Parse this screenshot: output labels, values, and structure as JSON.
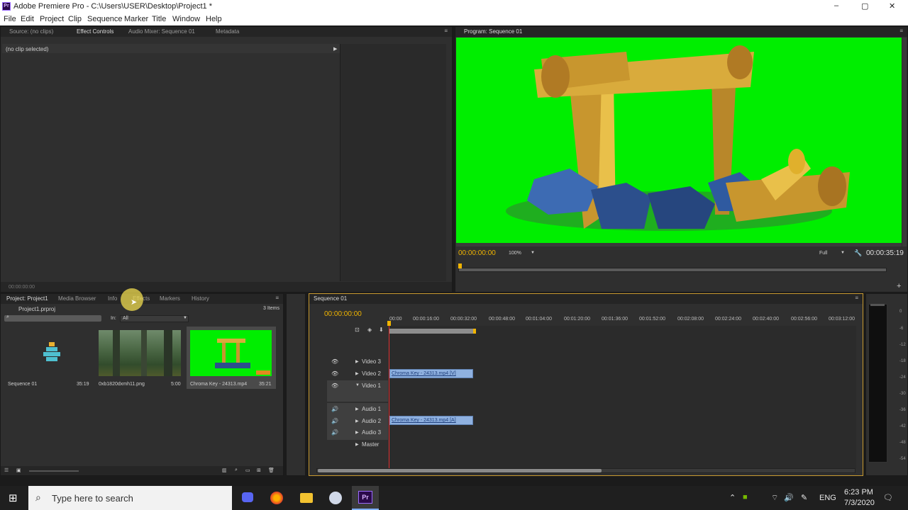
{
  "window": {
    "title": "Adobe Premiere Pro - C:\\Users\\USER\\Desktop\\Project1 *",
    "app_icon_label": "Pr",
    "controls": [
      "–",
      "▢",
      "✕"
    ]
  },
  "menu": [
    "File",
    "Edit",
    "Project",
    "Clip",
    "Sequence",
    "Marker",
    "Title",
    "Window",
    "Help"
  ],
  "source_panel": {
    "tabs": [
      "Source: (no clips)",
      "Effect Controls",
      "Audio Mixer: Sequence 01",
      "Metadata"
    ],
    "active_tab": "Effect Controls",
    "no_clip": "(no clip selected)",
    "timecode": "00:00:00:00"
  },
  "program_monitor": {
    "tab": "Program: Sequence 01",
    "timecode_current": "00:00:00:00",
    "zoom": "100%",
    "quality": "Full",
    "duration": "00:00:35:19"
  },
  "project_panel": {
    "tabs": [
      "Project: Project1",
      "Media Browser",
      "Info",
      "Effects",
      "Markers",
      "History"
    ],
    "active_tab": "Project: Project1",
    "file": "Project1.prproj",
    "item_count": "3 Items",
    "in_label": "In:",
    "in_value": "All",
    "items": [
      {
        "name": "Sequence 01",
        "duration": "35:19"
      },
      {
        "name": "0xb1820dxmh11.png",
        "duration": "5:00"
      },
      {
        "name": "Chroma Key - 24313.mp4",
        "duration": "35:21"
      }
    ]
  },
  "timeline": {
    "tab": "Sequence 01",
    "timecode": "00:00:00:00",
    "ruler": [
      "00:00",
      "00:00:16:00",
      "00:00:32:00",
      "00:00:48:00",
      "00:01:04:00",
      "00:01:20:00",
      "00:01:36:00",
      "00:01:52:00",
      "00:02:08:00",
      "00:02:24:00",
      "00:02:40:00",
      "00:02:56:00",
      "00:03:12:00"
    ],
    "video_tracks": [
      "Video 3",
      "Video 2",
      "Video 1"
    ],
    "audio_tracks": [
      "Audio 1",
      "Audio 2",
      "Audio 3",
      "Master"
    ],
    "video_clip": "Chroma Key - 24313.mp4 [V]",
    "audio_clip": "Chroma Key - 24313.mp4 [A]"
  },
  "vu_meter": [
    "0",
    "-6",
    "-12",
    "-18",
    "-24",
    "-30",
    "-36",
    "-42",
    "-48",
    "-54"
  ],
  "taskbar": {
    "search_placeholder": "Type here to search",
    "lang": "ENG",
    "time": "6:23 PM",
    "date": "7/3/2020"
  },
  "colors": {
    "chroma_green": "#00ee00",
    "timecode_orange": "#f0b400",
    "clip_blue": "#8fb1e0",
    "playhead_red": "#e03030"
  }
}
